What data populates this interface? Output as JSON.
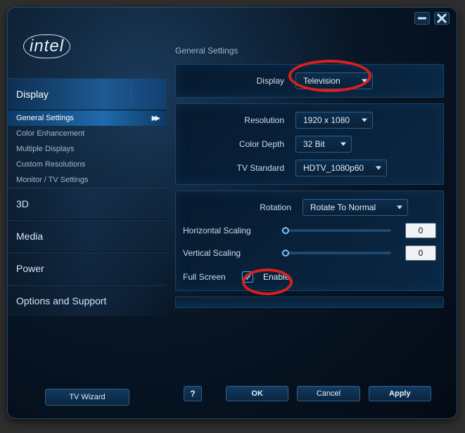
{
  "logo": "intel",
  "titlebar": {},
  "sidebar": {
    "nav": [
      {
        "label": "Display",
        "active": true
      },
      {
        "label": "3D"
      },
      {
        "label": "Media"
      },
      {
        "label": "Power"
      },
      {
        "label": "Options and Support"
      }
    ],
    "subnav": [
      {
        "label": "General Settings",
        "active": true
      },
      {
        "label": "Color Enhancement"
      },
      {
        "label": "Multiple Displays"
      },
      {
        "label": "Custom Resolutions"
      },
      {
        "label": "Monitor / TV Settings"
      }
    ],
    "tv_wizard": "TV Wizard"
  },
  "main": {
    "title": "General Settings",
    "labels": {
      "display": "Display",
      "resolution": "Resolution",
      "color_depth": "Color Depth",
      "tv_standard": "TV Standard",
      "rotation": "Rotation",
      "h_scaling": "Horizontal Scaling",
      "v_scaling": "Vertical Scaling",
      "full_screen": "Full Screen",
      "enable": "Enable"
    },
    "values": {
      "display": "Television",
      "resolution": "1920 x 1080",
      "color_depth": "32 Bit",
      "tv_standard": "HDTV_1080p60",
      "rotation": "Rotate To Normal",
      "h_scaling": "0",
      "v_scaling": "0",
      "full_screen_checked": true
    }
  },
  "footer": {
    "help": "?",
    "ok": "OK",
    "cancel": "Cancel",
    "apply": "Apply"
  }
}
